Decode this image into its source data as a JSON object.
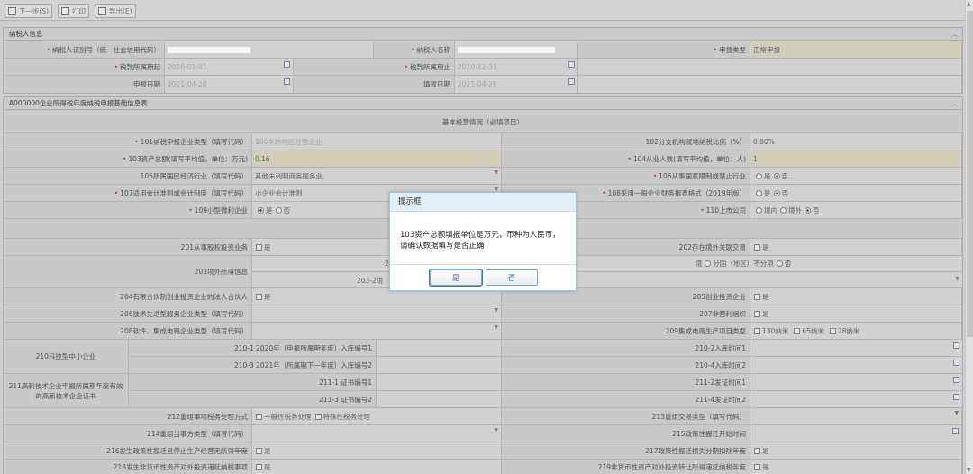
{
  "toolbar": {
    "next": "下一步(S)",
    "print": "打印",
    "export": "导出(E)"
  },
  "taxpayer": {
    "title": "纳税人信息",
    "id_label": "纳税人识别号（统一社会信用代码）",
    "name_label": "纳税人名称",
    "type_label": "申报类型",
    "type_value": "正常申报",
    "start_label": "税款所属期起",
    "start_value": "2020-01-01",
    "end_label": "税款所属期止",
    "end_value": "2020-12-31",
    "date_label": "申报日期",
    "date_value": "2021-04-28",
    "fill_label": "填报日期",
    "fill_value": "2021-04-28"
  },
  "form": {
    "title": "A000000企业所得税年度纳税申报基础信息表",
    "section1": "基本经营情况（必填项目）",
    "r101": "101纳税申报企业类型（填写代码）",
    "r101v": "100非跨地区经营企业",
    "r102": "102分支机构就地纳税比例（%）",
    "r102v": "0.00%",
    "r103": "103资产总额(填写平均值，单位：万元)",
    "r103v": "0.16",
    "r104": "104从业人数(填写平均值，单位：人)",
    "r104v": "1",
    "r105": "105所属国民经济行业（填写代码）",
    "r105v": "其他未列明商务服务业",
    "r106": "106从事国家限制或禁止行业",
    "yes": "是",
    "no": "否",
    "r107": "107适用会计准则或会计制度（填写代码）",
    "r107v": "小企业会计准则",
    "r108": "108采用一般企业财务报表格式（2019年版）",
    "r109": "109小型微利企业",
    "r110": "110上市公司",
    "in": "境内",
    "out": "境外",
    "r201": "201从事股权投资业务",
    "r202": "202存在境外关联交易",
    "r203": "203境外所得信息",
    "r203a": "2",
    "r203b": "203-2境",
    "r203c": "境",
    "r203d": "分国（地区）不分项",
    "r204": "204有限合伙制创业投资企业的法人合伙人",
    "r205": "205创业投资企业",
    "r206": "206技术先进型服务企业类型（填写代码）",
    "r207": "207非营利组织",
    "r208": "208软件、集成电路企业类型（填写代码）",
    "r209": "209集成电路生产项目类型",
    "n130": "130纳米",
    "n65": "65纳米",
    "n28": "28纳米",
    "r210": "210科技型中小企业",
    "r210_1": "210-1 2020年（申报所属期年度）入库编号1",
    "r210_2": "210-2入库时间1",
    "r210_3": "210-3 2021年（所属期下一年度）入库编号2",
    "r210_4": "210-4入库时间2",
    "r211": "211高新技术企业申报所属期年度有效的高新技术企业证书",
    "r211_1": "211-1 证书编号1",
    "r211_2": "211-2发证时间1",
    "r211_3": "211-3 证书编号2",
    "r211_4": "211-4发证时间2",
    "r212": "212重组事项税务处理方式",
    "r212a": "一般性税务处理",
    "r212b": "特殊性税务处理",
    "r213": "213重组交易类型（填写代码）",
    "r214": "214重组当事方类型（填写代码）",
    "r215": "215政策性搬迁开始时间",
    "r216": "216发生政策性搬迁且停止生产经营无所得年度",
    "r217": "217政策性搬迁损失分期扣除年度",
    "r218": "218发生非货币性资产对外投资递延纳税事项",
    "r219": "219非货币性资产对外投资转让所得递延纳税年度"
  },
  "dialog": {
    "title": "提示框",
    "message": "103资产总额填报单位是万元，币种为人民币，请确认数据填写是否正确",
    "yes": "是",
    "no": "否"
  }
}
